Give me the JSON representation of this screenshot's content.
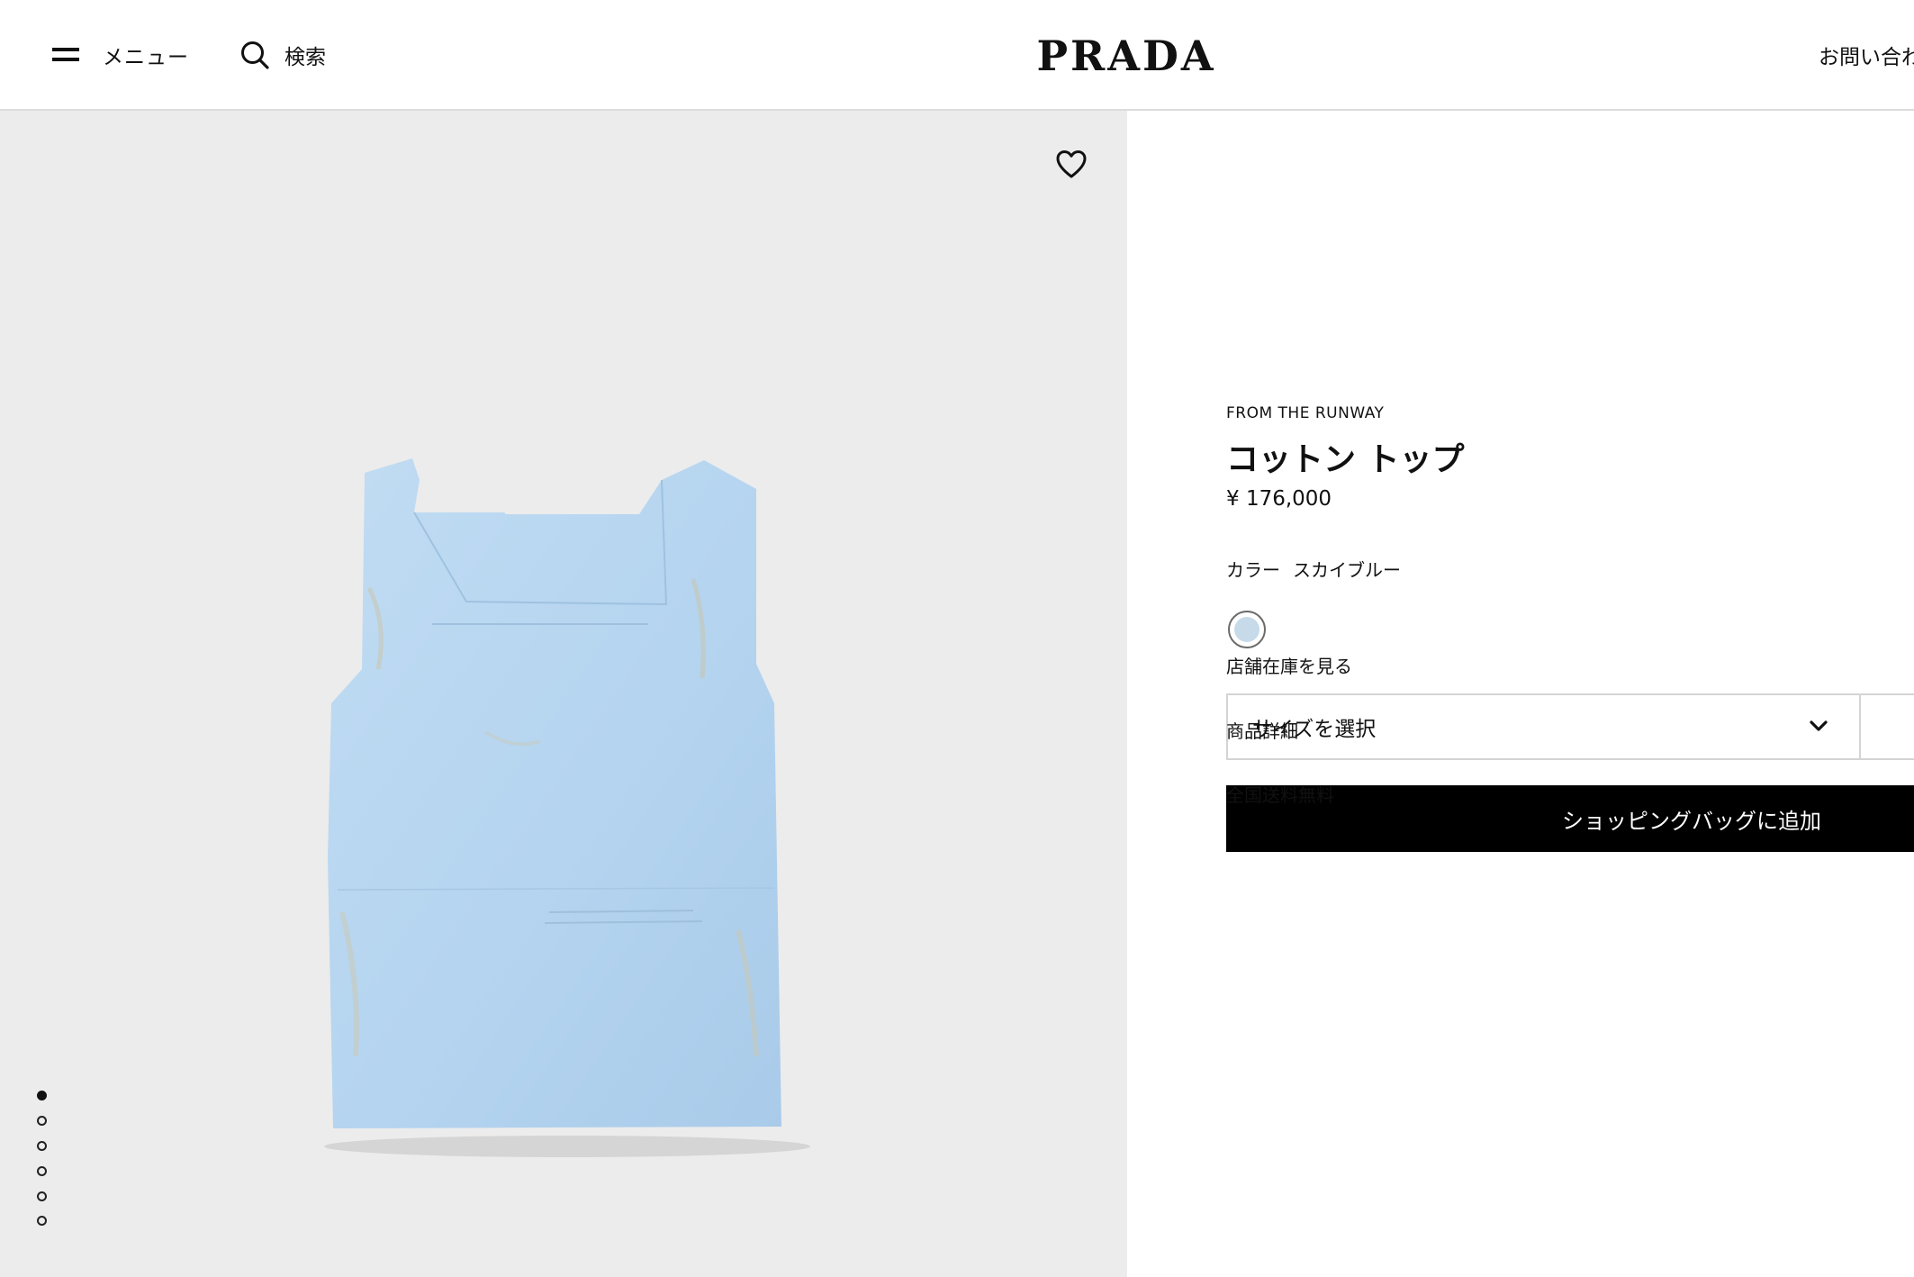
{
  "header": {
    "menu_label": "メニュー",
    "search_label": "検索",
    "logo_text": "PRADA",
    "contact_label": "お問い合わ"
  },
  "gallery": {
    "image_count": 6,
    "active_index": 0,
    "product_color_hex": "#b9d6ee"
  },
  "product": {
    "collection": "FROM THE RUNWAY",
    "title": "コットン トップ",
    "price": "¥ 176,000",
    "color_label": "カラー",
    "color_name": "スカイブルー",
    "swatch_hex": "#c6daea",
    "size_placeholder": "サイズを選択",
    "add_to_bag_label": "ショッピングバッグに追加",
    "links": {
      "store_stock": "店舗在庫を見る",
      "details": "商品詳細",
      "shipping": "全国送料無料"
    }
  },
  "colors": {
    "accent": "#000000",
    "image_bg": "#ececec"
  }
}
